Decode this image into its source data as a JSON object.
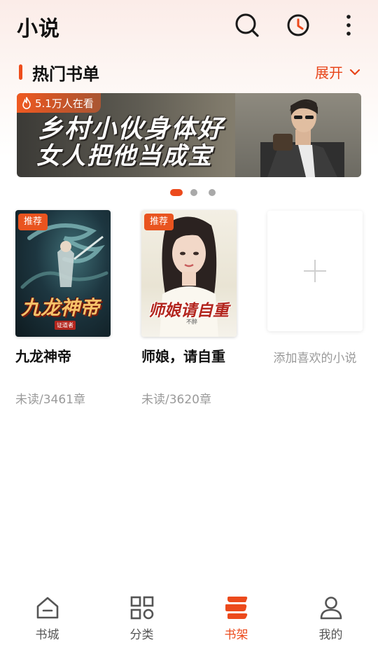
{
  "header": {
    "title": "小说",
    "icons": [
      "search-icon",
      "history-clock-icon",
      "more-vertical-icon"
    ]
  },
  "section": {
    "title": "热门书单",
    "expand_label": "展开"
  },
  "banner": {
    "viewers": "5.1万人在看",
    "line1": "乡村小伙身体好",
    "line2": "女人把他当成宝",
    "slides": 3,
    "active_slide": 1
  },
  "books": [
    {
      "tag": "推荐",
      "cover_text": "九龙神帝",
      "cover_publisher": "证道者",
      "title": "九龙神帝",
      "progress": "未读/3461章"
    },
    {
      "tag": "推荐",
      "cover_text": "师娘请自重",
      "cover_author": "不醉",
      "title": "师娘，请自重",
      "progress": "未读/3620章"
    }
  ],
  "add_book": {
    "label": "添加喜欢的小说"
  },
  "bottom_nav": [
    {
      "label": "书城",
      "icon": "home-icon"
    },
    {
      "label": "分类",
      "icon": "category-grid-icon"
    },
    {
      "label": "书架",
      "icon": "bookshelf-icon",
      "active": true
    },
    {
      "label": "我的",
      "icon": "profile-icon"
    }
  ],
  "colors": {
    "accent": "#ec4a1c",
    "muted": "#9a9a9a"
  }
}
